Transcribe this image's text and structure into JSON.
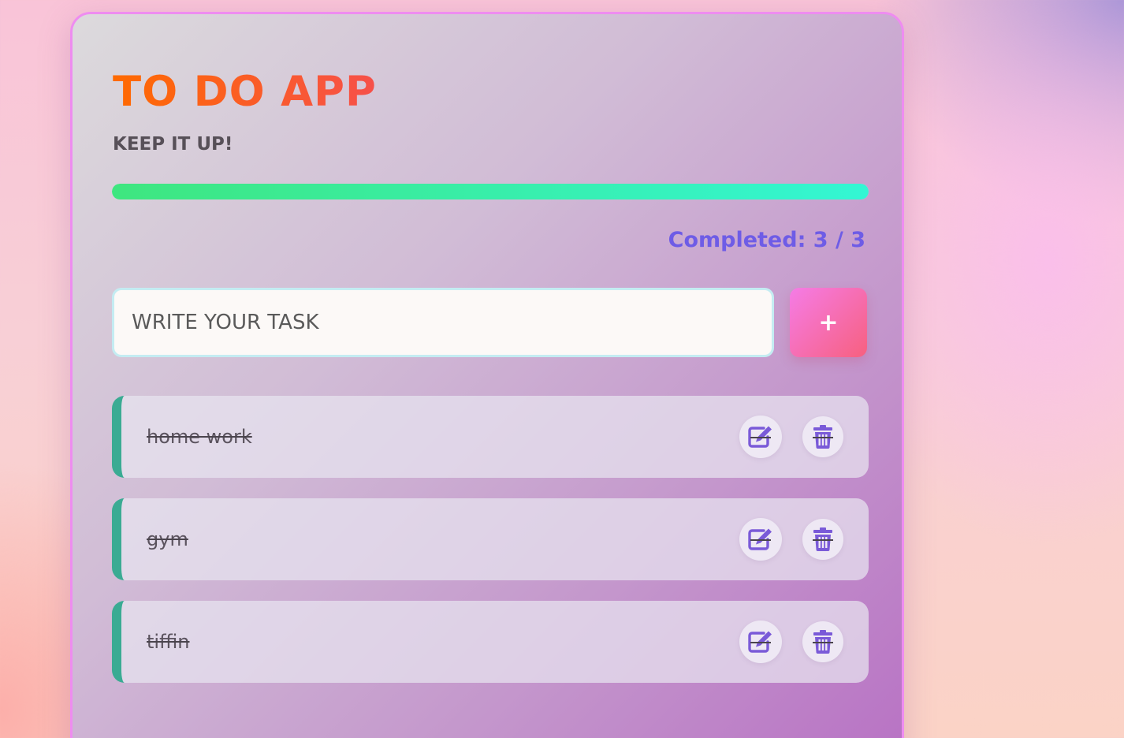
{
  "app": {
    "title": "TO DO APP",
    "subtitle": "KEEP IT UP!"
  },
  "progress": {
    "completed": 3,
    "total": 3,
    "fraction": 1.0,
    "label": "Completed: 3 / 3"
  },
  "input": {
    "placeholder": "WRITE YOUR TASK",
    "value": ""
  },
  "add_button": {
    "label": "+"
  },
  "tasks": [
    {
      "text": "home work",
      "completed": true,
      "edit_icon": "edit-icon",
      "delete_icon": "trash-icon"
    },
    {
      "text": "gym",
      "completed": true,
      "edit_icon": "edit-icon",
      "delete_icon": "trash-icon"
    },
    {
      "text": "tiffin",
      "completed": true,
      "edit_icon": "edit-icon",
      "delete_icon": "trash-icon"
    }
  ],
  "colors": {
    "title_gradient": [
      "#ff6a00",
      "#f6504a"
    ],
    "progress_gradient": [
      "#3ee67f",
      "#33f6d4"
    ],
    "completed_text": "#6e5ce6",
    "add_button_gradient": [
      "#f57ce6",
      "#f7607f"
    ],
    "task_accent": "#3aab93",
    "icon_color": "#7a5ad8"
  }
}
